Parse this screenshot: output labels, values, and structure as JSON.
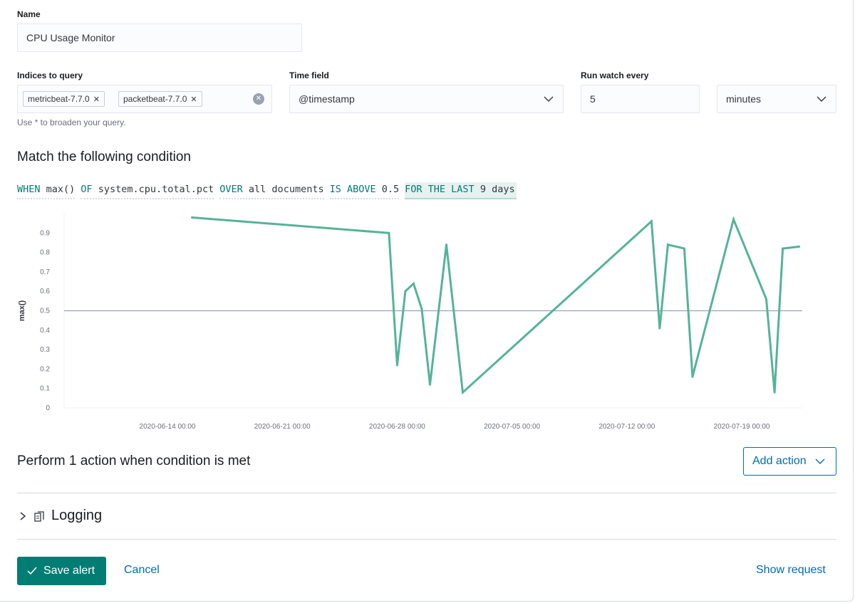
{
  "form": {
    "name_label": "Name",
    "name_value": "CPU Usage Monitor",
    "indices_label": "Indices to query",
    "indices": [
      "metricbeat-7.7.0",
      "packetbeat-7.7.0"
    ],
    "indices_help": "Use * to broaden your query.",
    "time_field_label": "Time field",
    "time_field_value": "@timestamp",
    "run_every_label": "Run watch every",
    "run_every_value": "5",
    "run_every_unit": "minutes"
  },
  "condition": {
    "title": "Match the following condition",
    "when_kw": "WHEN",
    "when_val": "max()",
    "of_kw": "OF",
    "of_val": "system.cpu.total.pct",
    "over_kw": "OVER",
    "over_val": "all documents",
    "is_kw": "IS ABOVE",
    "is_val": "0.5",
    "for_kw": "FOR THE LAST",
    "for_val": "9 days"
  },
  "chart_data": {
    "type": "line",
    "title": "",
    "xlabel": "",
    "ylabel": "max()",
    "ylim": [
      0,
      1.0
    ],
    "yticks": [
      "0",
      "0.1",
      "0.2",
      "0.3",
      "0.4",
      "0.5",
      "0.6",
      "0.7",
      "0.8",
      "0.9"
    ],
    "xtick_labels": [
      "2020-06-14 00:00",
      "2020-06-21 00:00",
      "2020-06-28 00:00",
      "2020-07-05 00:00",
      "2020-07-12 00:00",
      "2020-07-19 00:00"
    ],
    "threshold": 0.5,
    "line_color": "#54b399",
    "series": [
      {
        "points": [
          {
            "x": "2020-06-15 12:00",
            "y": 0.98
          },
          {
            "x": "2020-06-27 12:00",
            "y": 0.9
          },
          {
            "x": "2020-06-28 00:00",
            "y": 0.22
          },
          {
            "x": "2020-06-28 12:00",
            "y": 0.6
          },
          {
            "x": "2020-06-29 00:00",
            "y": 0.64
          },
          {
            "x": "2020-06-29 12:00",
            "y": 0.51
          },
          {
            "x": "2020-06-30 00:00",
            "y": 0.12
          },
          {
            "x": "2020-07-01 00:00",
            "y": 0.84
          },
          {
            "x": "2020-07-02 00:00",
            "y": 0.08
          },
          {
            "x": "2020-07-13 12:00",
            "y": 0.96
          },
          {
            "x": "2020-07-14 00:00",
            "y": 0.41
          },
          {
            "x": "2020-07-14 12:00",
            "y": 0.84
          },
          {
            "x": "2020-07-15 12:00",
            "y": 0.82
          },
          {
            "x": "2020-07-16 00:00",
            "y": 0.16
          },
          {
            "x": "2020-07-18 12:00",
            "y": 0.97
          },
          {
            "x": "2020-07-20 12:00",
            "y": 0.56
          },
          {
            "x": "2020-07-21 00:00",
            "y": 0.08
          },
          {
            "x": "2020-07-21 12:00",
            "y": 0.82
          },
          {
            "x": "2020-07-22 12:00",
            "y": 0.83
          }
        ]
      }
    ]
  },
  "actions": {
    "title": "Perform 1 action when condition is met",
    "add_action_label": "Add action",
    "logging_label": "Logging"
  },
  "footer": {
    "save_label": "Save alert",
    "cancel_label": "Cancel",
    "show_request_label": "Show request"
  },
  "colors": {
    "accent": "#017d73",
    "link": "#006bb4",
    "series": "#54b399"
  }
}
